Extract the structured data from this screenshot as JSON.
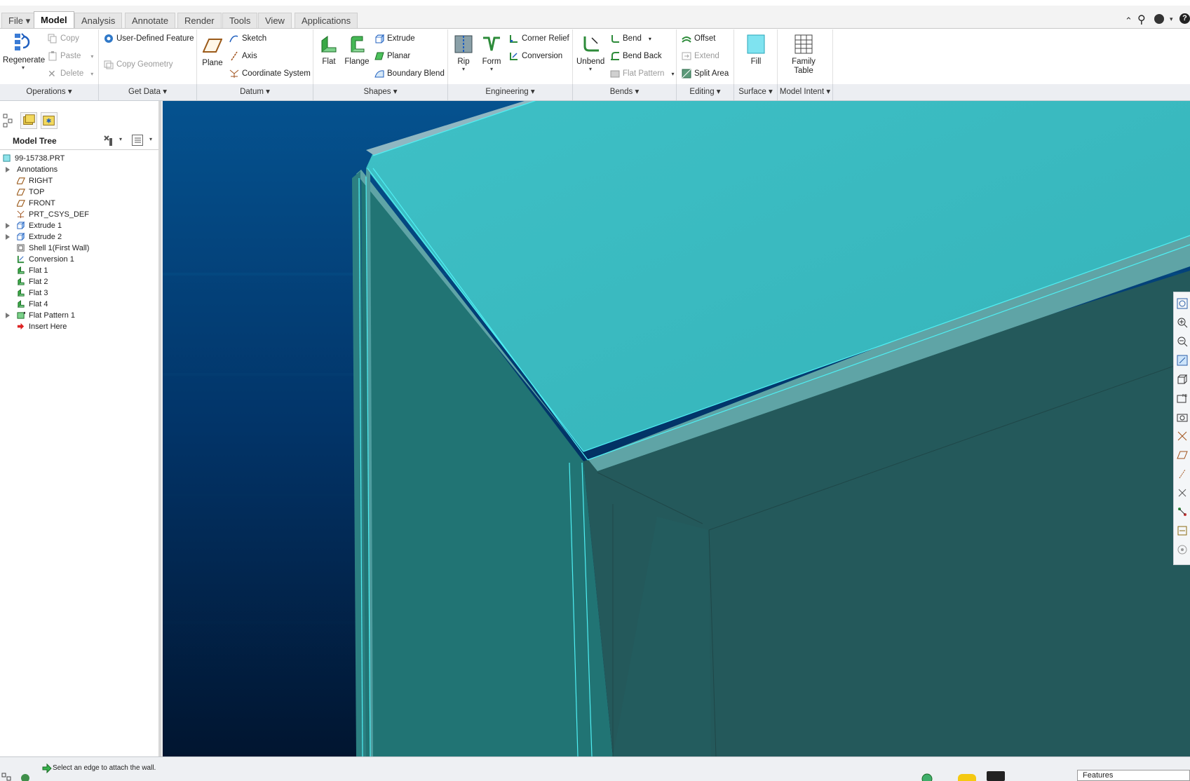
{
  "menu": {
    "file_label": "File",
    "tabs": [
      "Model",
      "Analysis",
      "Annotate",
      "Render",
      "Tools",
      "View",
      "Applications"
    ],
    "active_tab": "Model"
  },
  "ribbon": {
    "operations": {
      "regenerate": "Regenerate",
      "copy": "Copy",
      "paste": "Paste",
      "delete": "Delete"
    },
    "get_data": {
      "user_defined_feature": "User-Defined Feature",
      "copy_geometry": "Copy Geometry"
    },
    "datum": {
      "plane": "Plane",
      "sketch": "Sketch",
      "axis": "Axis",
      "coordinate_system": "Coordinate System"
    },
    "shapes": {
      "flat": "Flat",
      "flange": "Flange",
      "extrude": "Extrude",
      "planar": "Planar",
      "boundary_blend": "Boundary Blend"
    },
    "engineering": {
      "rip": "Rip",
      "form": "Form",
      "corner_relief": "Corner Relief",
      "conversion": "Conversion"
    },
    "bends": {
      "unbend": "Unbend",
      "bend": "Bend",
      "bend_back": "Bend Back",
      "flat_pattern": "Flat Pattern"
    },
    "editing": {
      "offset": "Offset",
      "extend": "Extend",
      "split_area": "Split Area"
    },
    "surface": {
      "fill": "Fill"
    },
    "model_intent": {
      "family_table_1": "Family",
      "family_table_2": "Table"
    }
  },
  "groups": [
    "Operations",
    "Get Data",
    "Datum",
    "Shapes",
    "Engineering",
    "Bends",
    "Editing",
    "Surface",
    "Model Intent"
  ],
  "model_tree": {
    "title": "Model Tree",
    "items": [
      {
        "label": "99-15738.PRT",
        "icon": "part-icon",
        "expandable": false
      },
      {
        "label": "Annotations",
        "icon": "",
        "expandable": true
      },
      {
        "label": "RIGHT",
        "icon": "datum-plane-icon",
        "expandable": false
      },
      {
        "label": "TOP",
        "icon": "datum-plane-icon",
        "expandable": false
      },
      {
        "label": "FRONT",
        "icon": "datum-plane-icon",
        "expandable": false
      },
      {
        "label": "PRT_CSYS_DEF",
        "icon": "csys-icon",
        "expandable": false
      },
      {
        "label": "Extrude 1",
        "icon": "extrude-icon",
        "expandable": true
      },
      {
        "label": "Extrude 2",
        "icon": "extrude-icon",
        "expandable": true
      },
      {
        "label": "Shell 1(First Wall)",
        "icon": "shell-icon",
        "expandable": false
      },
      {
        "label": "Conversion 1",
        "icon": "conversion-icon",
        "expandable": false
      },
      {
        "label": "Flat 1",
        "icon": "flat-wall-icon",
        "expandable": false
      },
      {
        "label": "Flat 2",
        "icon": "flat-wall-icon",
        "expandable": false
      },
      {
        "label": "Flat 3",
        "icon": "flat-wall-icon",
        "expandable": false
      },
      {
        "label": "Flat 4",
        "icon": "flat-wall-icon",
        "expandable": false
      },
      {
        "label": "Flat Pattern 1",
        "icon": "flat-pattern-icon",
        "expandable": true
      },
      {
        "label": "Insert Here",
        "icon": "insert-arrow-icon",
        "expandable": false
      }
    ]
  },
  "status": {
    "message": "Select an edge to attach the wall.",
    "filter": "Features"
  },
  "colors": {
    "background_top": "#05528f",
    "background_bottom": "#011530",
    "model_top_face": "#3dbdc3",
    "model_side_face": "#217070",
    "model_right_face": "#245a5c",
    "edge_highlight": "#4ff0f4"
  }
}
